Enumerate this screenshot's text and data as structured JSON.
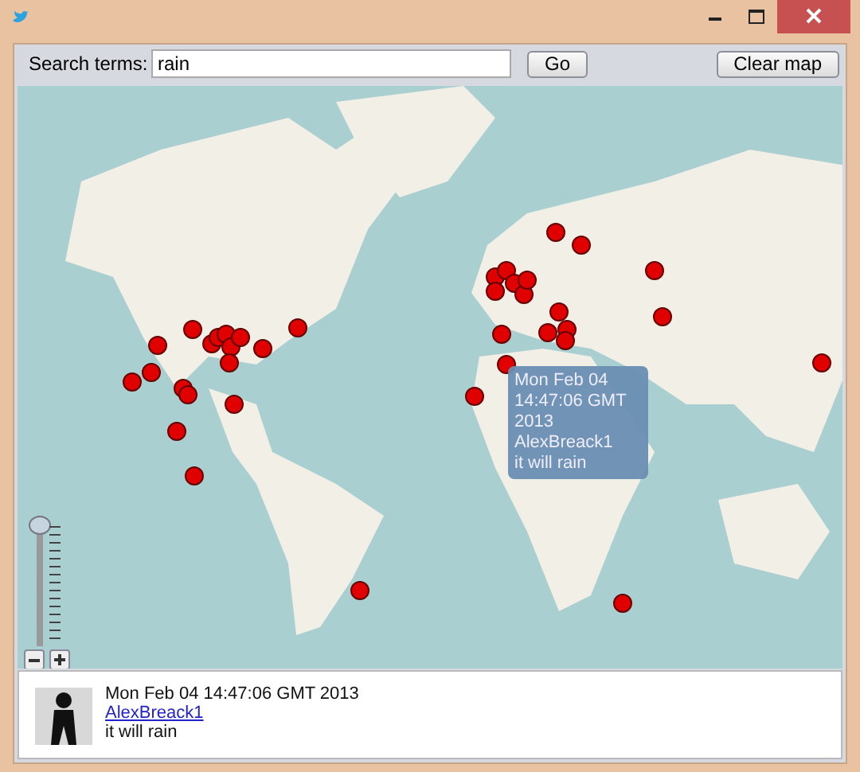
{
  "search": {
    "label": "Search terms:",
    "value": "rain"
  },
  "buttons": [
    {
      "kind": "go",
      "label": "Go"
    },
    {
      "kind": "clear",
      "label": "Clear map"
    }
  ],
  "map": {
    "zoom_slider": {
      "level": 1
    },
    "tooltip": {
      "lines": [
        "Mon Feb 04",
        "14:47:06 GMT",
        "2013",
        "AlexBreack1",
        "it will rain"
      ]
    }
  },
  "tweet": {
    "date": "Mon Feb 04 14:47:06 GMT 2013",
    "user": "AlexBreack1",
    "text": "it will rain"
  }
}
